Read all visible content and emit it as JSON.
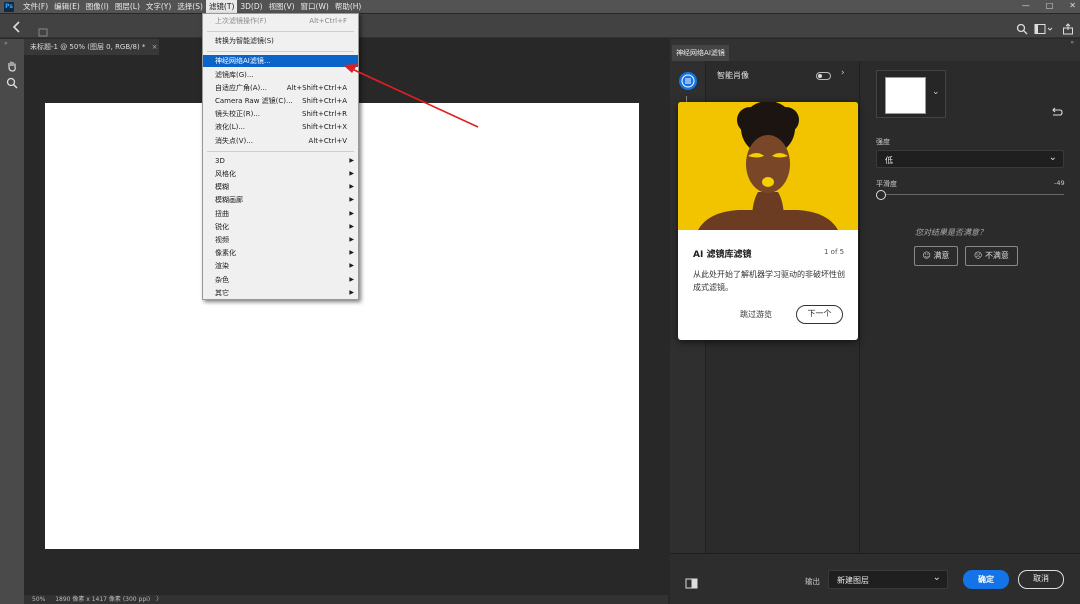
{
  "menubar": {
    "logo": "Ps",
    "items": [
      "文件(F)",
      "编辑(E)",
      "图像(I)",
      "图层(L)",
      "文字(Y)",
      "选择(S)",
      "滤镜(T)",
      "3D(D)",
      "视图(V)",
      "窗口(W)",
      "帮助(H)"
    ],
    "active_index": 6
  },
  "window_controls": {
    "minimize": "—",
    "maximize": "□",
    "close": "✕"
  },
  "document": {
    "tab_title": "未标题-1 @ 50% (图层 0, RGB/8) *",
    "tab_close": "×",
    "status_zoom": "50%",
    "status_info": "1890 像素 x 1417 像素 (300 ppi)",
    "status_arrow": "〉"
  },
  "filter_menu": {
    "items": [
      {
        "label": "上次滤镜操作(F)",
        "shortcut": "Alt+Ctrl+F",
        "disabled": true
      },
      {
        "sep": true
      },
      {
        "label": "转换为智能滤镜(S)",
        "shortcut": "",
        "disabled": false
      },
      {
        "sep": true
      },
      {
        "label": "神经网络AI滤镜...",
        "shortcut": "",
        "highlight": true
      },
      {
        "label": "滤镜库(G)...",
        "shortcut": ""
      },
      {
        "label": "自适应广角(A)...",
        "shortcut": "Alt+Shift+Ctrl+A"
      },
      {
        "label": "Camera Raw 滤镜(C)...",
        "shortcut": "Shift+Ctrl+A"
      },
      {
        "label": "镜头校正(R)...",
        "shortcut": "Shift+Ctrl+R"
      },
      {
        "label": "液化(L)...",
        "shortcut": "Shift+Ctrl+X"
      },
      {
        "label": "消失点(V)...",
        "shortcut": "Alt+Ctrl+V"
      },
      {
        "sep": true
      },
      {
        "label": "3D",
        "submenu": true
      },
      {
        "label": "风格化",
        "submenu": true
      },
      {
        "label": "模糊",
        "submenu": true
      },
      {
        "label": "模糊画廊",
        "submenu": true
      },
      {
        "label": "扭曲",
        "submenu": true
      },
      {
        "label": "锐化",
        "submenu": true
      },
      {
        "label": "视频",
        "submenu": true
      },
      {
        "label": "像素化",
        "submenu": true
      },
      {
        "label": "渲染",
        "submenu": true
      },
      {
        "label": "杂色",
        "submenu": true
      },
      {
        "label": "其它",
        "submenu": true
      }
    ]
  },
  "panel": {
    "tab_label": "神经网络AI滤镜",
    "list": {
      "first_item": "智能肖像"
    },
    "settings": {
      "strength_label": "强度",
      "strength_value": "低",
      "smooth_label": "平滑度",
      "smooth_value": "-49",
      "smooth_fraction": 0.0,
      "feedback_question": "您对结果是否满意？",
      "satisfied_label": "满意",
      "unsatisfied_label": "不满意"
    },
    "footer": {
      "output_label": "输出",
      "output_value": "新建图层",
      "ok_label": "确定",
      "cancel_label": "取消"
    }
  },
  "tour": {
    "title": "AI 滤镜库滤镜",
    "counter": "1 of 5",
    "body": "从此处开始了解机器学习驱动的非破坏性创成式滤镜。",
    "skip_label": "跳过游览",
    "next_label": "下一个"
  },
  "colors": {
    "accent": "#1473e6",
    "menu_highlight": "#0b64c8",
    "annotation_arrow": "#e02020",
    "tour_image_bg": "#f2c400"
  }
}
